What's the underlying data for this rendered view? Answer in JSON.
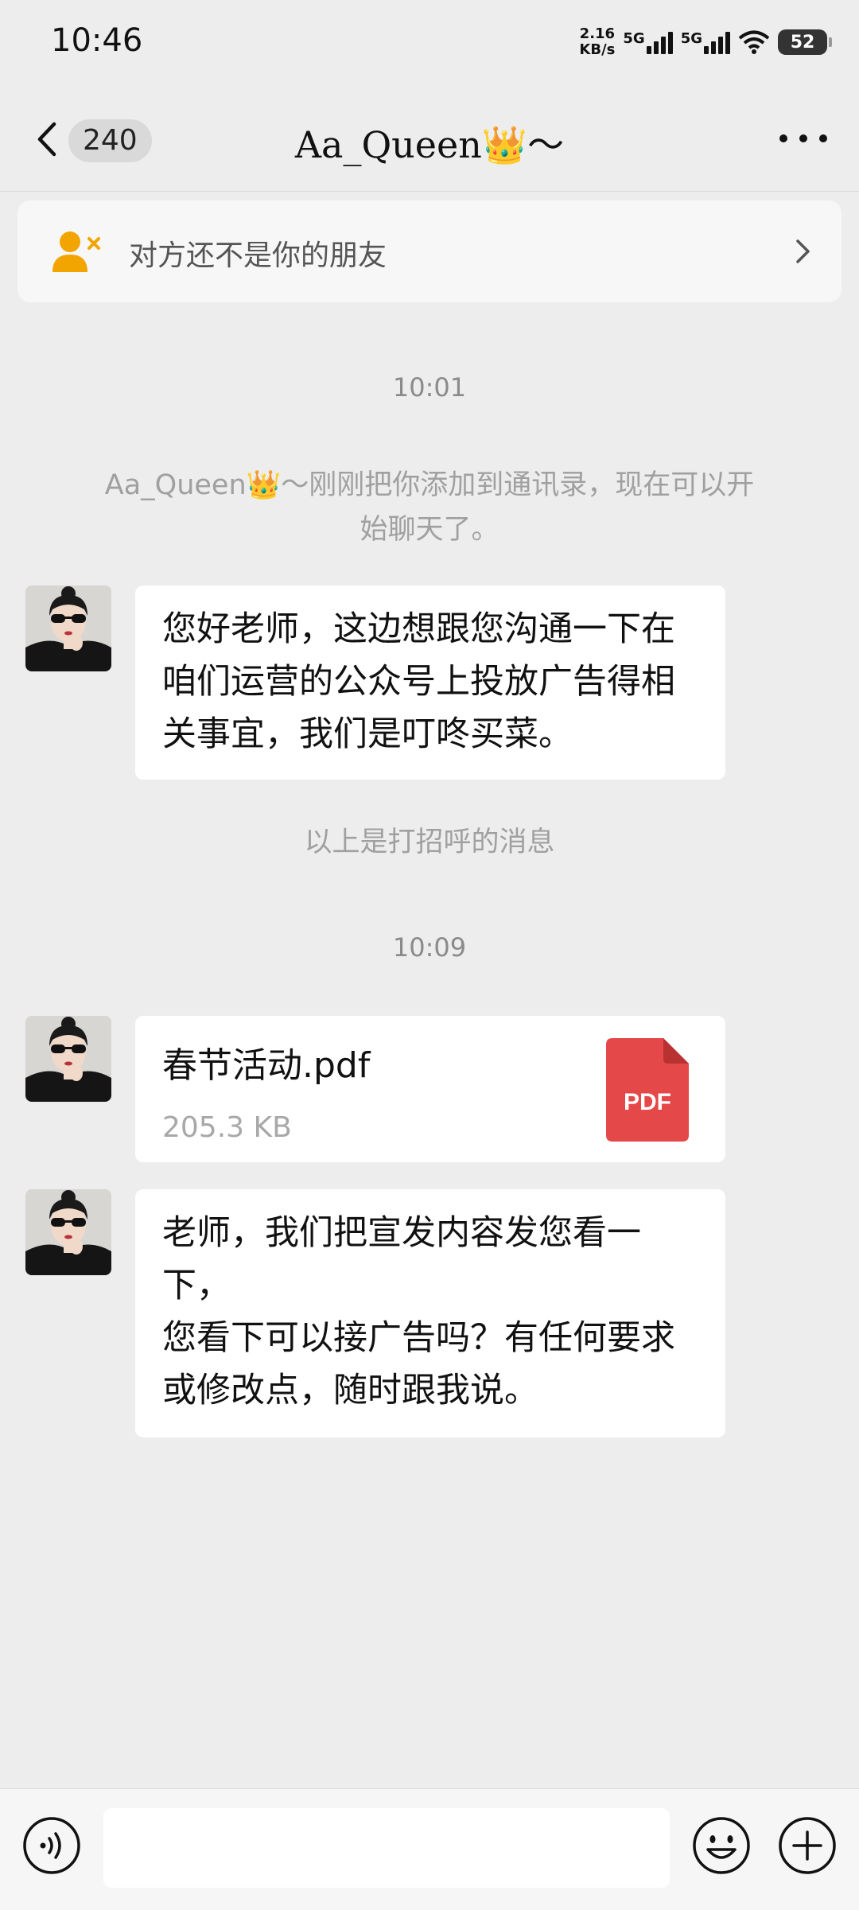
{
  "status_bar": {
    "time": "10:46",
    "net_speed_value": "2.16",
    "net_speed_unit": "KB/s",
    "network_1": "5G",
    "network_2": "5G",
    "battery": "52"
  },
  "header": {
    "unread_count": "240",
    "title": "Aa_Queen👑～"
  },
  "banner": {
    "text": "对方还不是你的朋友"
  },
  "chat": {
    "time_1": "10:01",
    "system_msg_line1": "Aa_Queen👑～刚刚把你添加到通讯录，现在可以开",
    "system_msg_line2": "始聊天了。",
    "message_1": [
      "您好老师，这边想跟您沟通一下在",
      "咱们运营的公众号上投放广告得相",
      "关事宜，我们是叮咚买菜。"
    ],
    "greeting_note": "以上是打招呼的消息",
    "time_2": "10:09",
    "file": {
      "name": "春节活动.pdf",
      "size": "205.3 KB",
      "icon_label": "PDF"
    },
    "message_3": [
      "老师，我们把宣发内容发您看一",
      "下，",
      "您看下可以接广告吗？有任何要求",
      "或修改点，随时跟我说。"
    ]
  },
  "colors": {
    "background": "#ededed",
    "bubble": "#ffffff",
    "pdf_red": "#e54848",
    "banner_icon": "#f2a500"
  },
  "icons": [
    "back-icon",
    "more-icon",
    "add-friend-icon",
    "chevron-right-icon",
    "pdf-icon",
    "voice-icon",
    "emoji-icon",
    "plus-icon"
  ]
}
